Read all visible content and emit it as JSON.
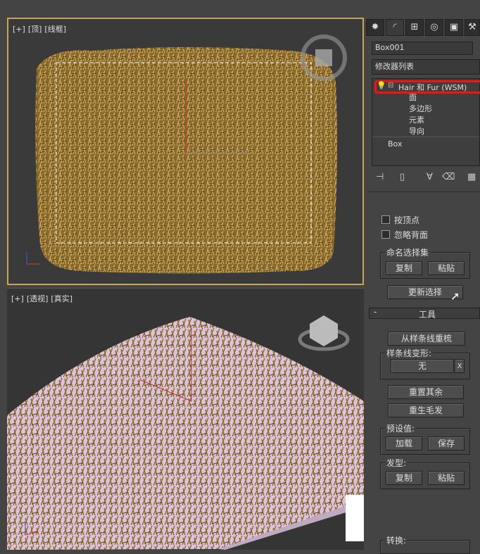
{
  "viewports": {
    "top": {
      "plus": "[+]",
      "view": "[顶]",
      "shading": "[线框]"
    },
    "perspective": {
      "plus": "[+]",
      "view": "[透视]",
      "shading": "[真实]"
    }
  },
  "command_panel": {
    "tab_icons": [
      "create-icon",
      "modify-icon",
      "hierarchy-icon",
      "motion-icon",
      "display-icon",
      "utilities-icon"
    ],
    "object_name": "Box001",
    "modifier_list": "修改器列表",
    "stack": {
      "modifier": "Hair 和 Fur (WSM)",
      "sub_levels": [
        "面",
        "多边形",
        "元素",
        "导向"
      ],
      "base_object": "Box"
    },
    "selection": {
      "by_vertex": "按顶点",
      "ignore_backfacing": "忽略背面",
      "named_sets_title": "命名选择集",
      "copy": "复制",
      "paste": "粘贴",
      "update_selection": "更新选择"
    },
    "tools": {
      "rollout_minus": "-",
      "rollout_title": "工具",
      "recomb_from_splines": "从样条线重梳",
      "spline_deform_title": "样条线变形:",
      "spline_value": "无",
      "spline_clear": "X",
      "reset_rest": "重置其余",
      "regrow_hair": "重生毛发",
      "presets_title": "预设值:",
      "load": "加载",
      "save": "保存",
      "hairdo_title": "发型:",
      "copy": "复制",
      "paste": "粘贴",
      "convert_title": "转换:"
    }
  }
}
